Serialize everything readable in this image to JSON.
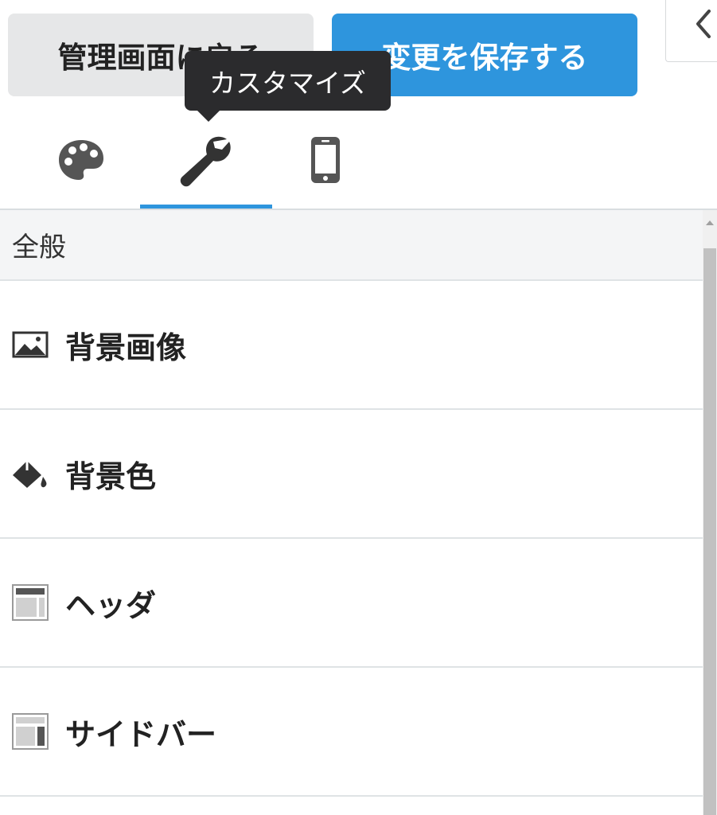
{
  "header": {
    "back_label": "管理画面に戻る",
    "save_label": "変更を保存する"
  },
  "tooltip": {
    "text": "カスタマイズ"
  },
  "tabs": [
    {
      "icon": "palette-icon",
      "active": false
    },
    {
      "icon": "wrench-icon",
      "active": true
    },
    {
      "icon": "mobile-phone-icon",
      "active": false
    }
  ],
  "section": {
    "title": "全般"
  },
  "menu": [
    {
      "label": "背景画像",
      "icon": "image-icon"
    },
    {
      "label": "背景色",
      "icon": "paint-bucket-icon"
    },
    {
      "label": "ヘッダ",
      "icon": "header-layout-icon"
    },
    {
      "label": "サイドバー",
      "icon": "sidebar-layout-icon"
    }
  ],
  "colors": {
    "accent": "#2e95dd",
    "tooltip_bg": "#2b2b2d",
    "back_button_bg": "#e6e7e8",
    "icon": "#555555"
  }
}
